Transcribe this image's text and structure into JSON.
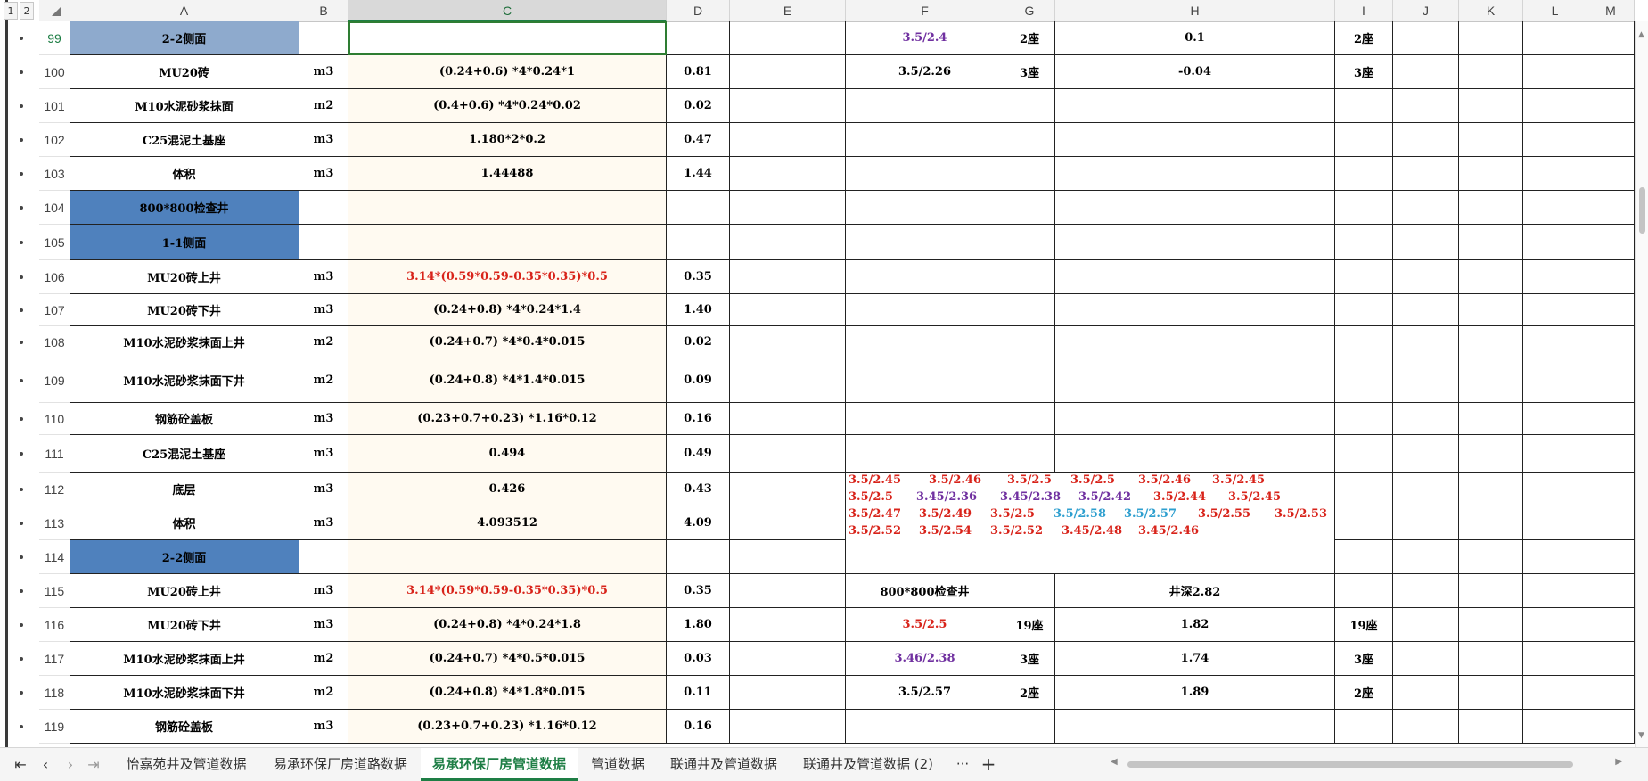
{
  "outline": {
    "level1": "1",
    "level2": "2"
  },
  "columns": [
    "A",
    "B",
    "C",
    "D",
    "E",
    "F",
    "G",
    "H",
    "I",
    "J",
    "K",
    "L",
    "M"
  ],
  "selected_column": "C",
  "rows": [
    {
      "num": "99",
      "A": "2-2侧面",
      "B": "",
      "C": "",
      "D": "",
      "F": "3.5/2.4",
      "G": "2座",
      "H": "0.1",
      "I": "2座",
      "style": "lblue"
    },
    {
      "num": "100",
      "A": "MU20砖",
      "B": "m3",
      "C": "(0.24+0.6) *4*0.24*1",
      "D": "0.81",
      "F": "3.5/2.26",
      "G": "3座",
      "H": "-0.04",
      "I": "3座"
    },
    {
      "num": "101",
      "A": "M10水泥砂浆抹面",
      "B": "m2",
      "C": "(0.4+0.6) *4*0.24*0.02",
      "D": "0.02"
    },
    {
      "num": "102",
      "A": "C25混泥土基座",
      "B": "m3",
      "C": "1.180*2*0.2",
      "D": "0.47"
    },
    {
      "num": "103",
      "A": "体积",
      "B": "m3",
      "C": "1.44488",
      "D": "1.44"
    },
    {
      "num": "104",
      "A": "800*800检查井",
      "B": "",
      "C": "",
      "D": "",
      "style": "blue"
    },
    {
      "num": "105",
      "A": "1-1侧面",
      "B": "",
      "C": "",
      "D": "",
      "style": "blue"
    },
    {
      "num": "106",
      "A": "MU20砖上井",
      "B": "m3",
      "C": "3.14*(0.59*0.59-0.35*0.35)*0.5",
      "D": "0.35",
      "c_red": true
    },
    {
      "num": "107",
      "A": "MU20砖下井",
      "B": "m3",
      "C": "(0.24+0.8) *4*0.24*1.4",
      "D": "1.40"
    },
    {
      "num": "108",
      "A": "M10水泥砂浆抹面上井",
      "B": "m2",
      "C": "(0.24+0.7) *4*0.4*0.015",
      "D": "0.02"
    },
    {
      "num": "109",
      "A": "M10水泥砂浆抹面下井",
      "B": "m2",
      "C": "(0.24+0.8) *4*1.4*0.015",
      "D": "0.09"
    },
    {
      "num": "110",
      "A": "钢筋砼盖板",
      "B": "m3",
      "C": "(0.23+0.7+0.23) *1.16*0.12",
      "D": "0.16"
    },
    {
      "num": "111",
      "A": "C25混泥土基座",
      "B": "m3",
      "C": "0.494",
      "D": "0.49"
    },
    {
      "num": "112",
      "A": "底层",
      "B": "m3",
      "C": "0.426",
      "D": "0.43"
    },
    {
      "num": "113",
      "A": "体积",
      "B": "m3",
      "C": "4.093512",
      "D": "4.09"
    },
    {
      "num": "114",
      "A": "2-2侧面",
      "B": "",
      "C": "",
      "D": "",
      "style": "blue"
    },
    {
      "num": "115",
      "A": "MU20砖上井",
      "B": "m3",
      "C": "3.14*(0.59*0.59-0.35*0.35)*0.5",
      "D": "0.35",
      "F": "800*800检查井",
      "H": "井深2.82",
      "c_red": true
    },
    {
      "num": "116",
      "A": "MU20砖下井",
      "B": "m3",
      "C": "(0.24+0.8) *4*0.24*1.8",
      "D": "1.80",
      "F": "3.5/2.5",
      "G": "19座",
      "H": "1.82",
      "I": "19座",
      "f_color": "red"
    },
    {
      "num": "117",
      "A": "M10水泥砂浆抹面上井",
      "B": "m2",
      "C": "(0.24+0.7) *4*0.5*0.015",
      "D": "0.03",
      "F": "3.46/2.38",
      "G": "3座",
      "H": "1.74",
      "I": "3座",
      "f_color": "purple"
    },
    {
      "num": "118",
      "A": "M10水泥砂浆抹面下井",
      "B": "m2",
      "C": "(0.24+0.8) *4*1.8*0.015",
      "D": "0.11",
      "F": "3.5/2.57",
      "G": "2座",
      "H": "1.89",
      "I": "2座"
    },
    {
      "num": "119",
      "A": "钢筋砼盖板",
      "B": "m3",
      "C": "(0.23+0.7+0.23) *1.16*0.12",
      "D": "0.16"
    }
  ],
  "merged_note_lines": [
    [
      {
        "t": "3.5/2.45",
        "c": "red"
      },
      {
        "t": "3.5/2.46",
        "c": "red"
      },
      {
        "t": "3.5/2.5",
        "c": "red"
      },
      {
        "t": "3.5/2.5",
        "c": "red"
      },
      {
        "t": "3.5/2.46",
        "c": "red"
      },
      {
        "t": "3.5/2.45",
        "c": "red"
      }
    ],
    [
      {
        "t": "3.5/2.5",
        "c": "red"
      },
      {
        "t": "3.45/2.36",
        "c": "purple"
      },
      {
        "t": "3.45/2.38",
        "c": "purple"
      },
      {
        "t": "3.5/2.42",
        "c": "purple"
      },
      {
        "t": "3.5/2.44",
        "c": "red"
      },
      {
        "t": "3.5/2.45",
        "c": "red"
      }
    ],
    [
      {
        "t": "3.5/2.47",
        "c": "red"
      },
      {
        "t": "3.5/2.49",
        "c": "red"
      },
      {
        "t": "3.5/2.5",
        "c": "red"
      },
      {
        "t": "3.5/2.58",
        "c": "cyan"
      },
      {
        "t": "3.5/2.57",
        "c": "cyan"
      },
      {
        "t": "3.5/2.55",
        "c": "red"
      },
      {
        "t": "3.5/2.53",
        "c": "red"
      }
    ],
    [
      {
        "t": "3.5/2.52",
        "c": "red"
      },
      {
        "t": "3.5/2.54",
        "c": "red"
      },
      {
        "t": "3.5/2.52",
        "c": "red"
      },
      {
        "t": "3.45/2.48",
        "c": "red"
      },
      {
        "t": "3.45/2.46",
        "c": "red"
      }
    ]
  ],
  "sheet_tabs": [
    "怡嘉苑井及管道数据",
    "易承环保厂房道路数据",
    "易承环保厂房管道数据",
    "管道数据",
    "联通井及管道数据",
    "联通井及管道数据 (2)"
  ],
  "active_tab": "易承环保厂房管道数据",
  "tab_more": "···",
  "tab_add": "+",
  "colors": {
    "header_blue": "#4f81bd",
    "light_blue": "#8eaacd",
    "cream": "#fffaf1",
    "accent_green": "#1e7e45",
    "red": "#d8231a",
    "purple": "#7030a0",
    "cyan": "#2e9fcf"
  }
}
